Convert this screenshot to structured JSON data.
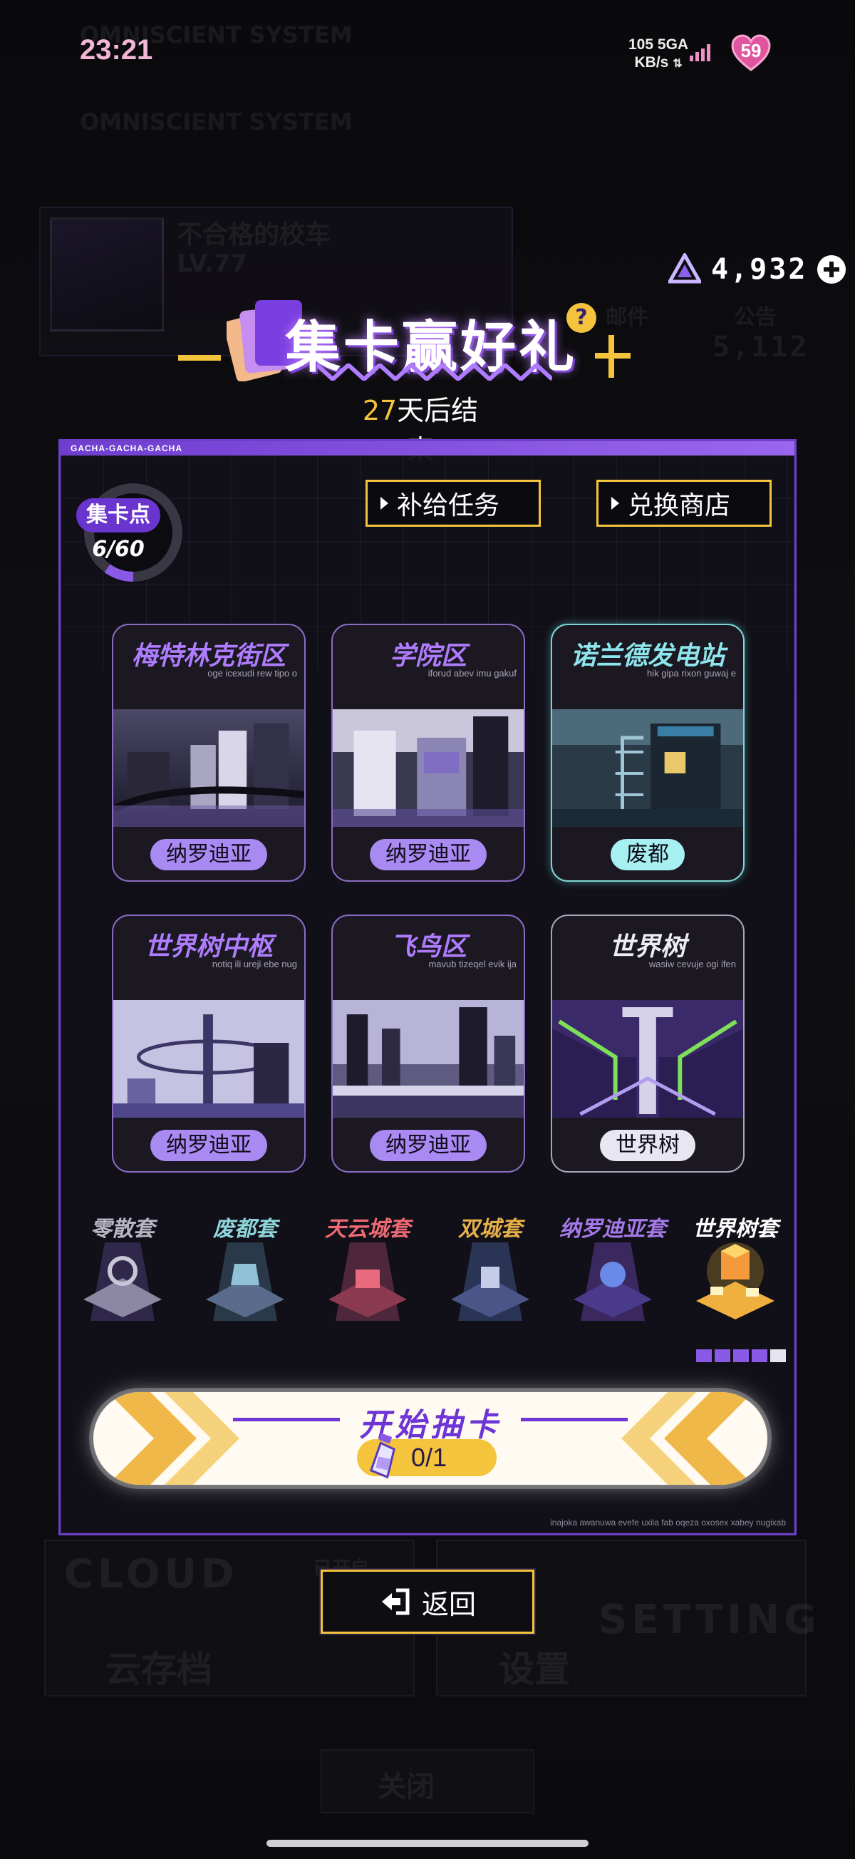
{
  "status_bar": {
    "time": "23:21",
    "network_speed": "105",
    "network_unit": "KB/s",
    "network_type": "5GA",
    "battery": "59"
  },
  "background": {
    "brand": "OMNISCIENT SYSTEM",
    "profile_name": "不合格的校车",
    "profile_level": "LV.77",
    "secondary_currency": "5,112",
    "mail_label": "邮件",
    "notice_label": "公告",
    "cloud_label": "CLOUD",
    "cloud_save": "云存档",
    "cloud_open": "已开启",
    "setting_label": "SETTING",
    "settings": "设置",
    "close": "关闭"
  },
  "currency": {
    "value": "4,932",
    "icon": "crystal-icon"
  },
  "event": {
    "title": "集卡赢好礼",
    "days_left": "27",
    "countdown_suffix": "天后结束"
  },
  "panel": {
    "header": "GACHA-GACHA-GACHA",
    "points_label": "集卡点",
    "points_value": "6/60",
    "points_fraction": 0.1,
    "supplement_button": "补给任务",
    "shop_button": "兑换商店",
    "footer": "inajoka awanuwa evefe uxila fab oqeza oxosex xabey nugixab"
  },
  "districts": [
    {
      "title": "梅特林克街区",
      "subtitle": "oge icexudi rew tipo o",
      "tag": "纳罗迪亚"
    },
    {
      "title": "学院区",
      "subtitle": "iforud abev imu gakuf",
      "tag": "纳罗迪亚"
    },
    {
      "title": "诺兰德发电站",
      "subtitle": "hik gipa rixon guwaj e",
      "tag": "废都"
    },
    {
      "title": "世界树中枢",
      "subtitle": "notiq ili ureji ebe nug",
      "tag": "纳罗迪亚"
    },
    {
      "title": "飞鸟区",
      "subtitle": "mavub tizeqel evik ija",
      "tag": "纳罗迪亚"
    },
    {
      "title": "世界树",
      "subtitle": "wasiw cevuje ogi ifen",
      "tag": "世界树"
    }
  ],
  "sets": [
    {
      "name": "零散套",
      "color": "#b9b6c4"
    },
    {
      "name": "废都套",
      "color": "#8ed6dc"
    },
    {
      "name": "天云城套",
      "color": "#ee6a74"
    },
    {
      "name": "双城套",
      "color": "#e6b04a"
    },
    {
      "name": "纳罗迪亚套",
      "color": "#a47ae8"
    },
    {
      "name": "世界树套",
      "color": "#ffffff"
    }
  ],
  "set_progress": {
    "filled": 4,
    "total": 5
  },
  "gacha": {
    "label": "开始抽卡",
    "count": "0/1"
  },
  "back_button": {
    "label": "返回",
    "icon": "exit-icon"
  },
  "colors": {
    "accent_purple": "#6c3fc4",
    "gold": "#f4c43c"
  }
}
